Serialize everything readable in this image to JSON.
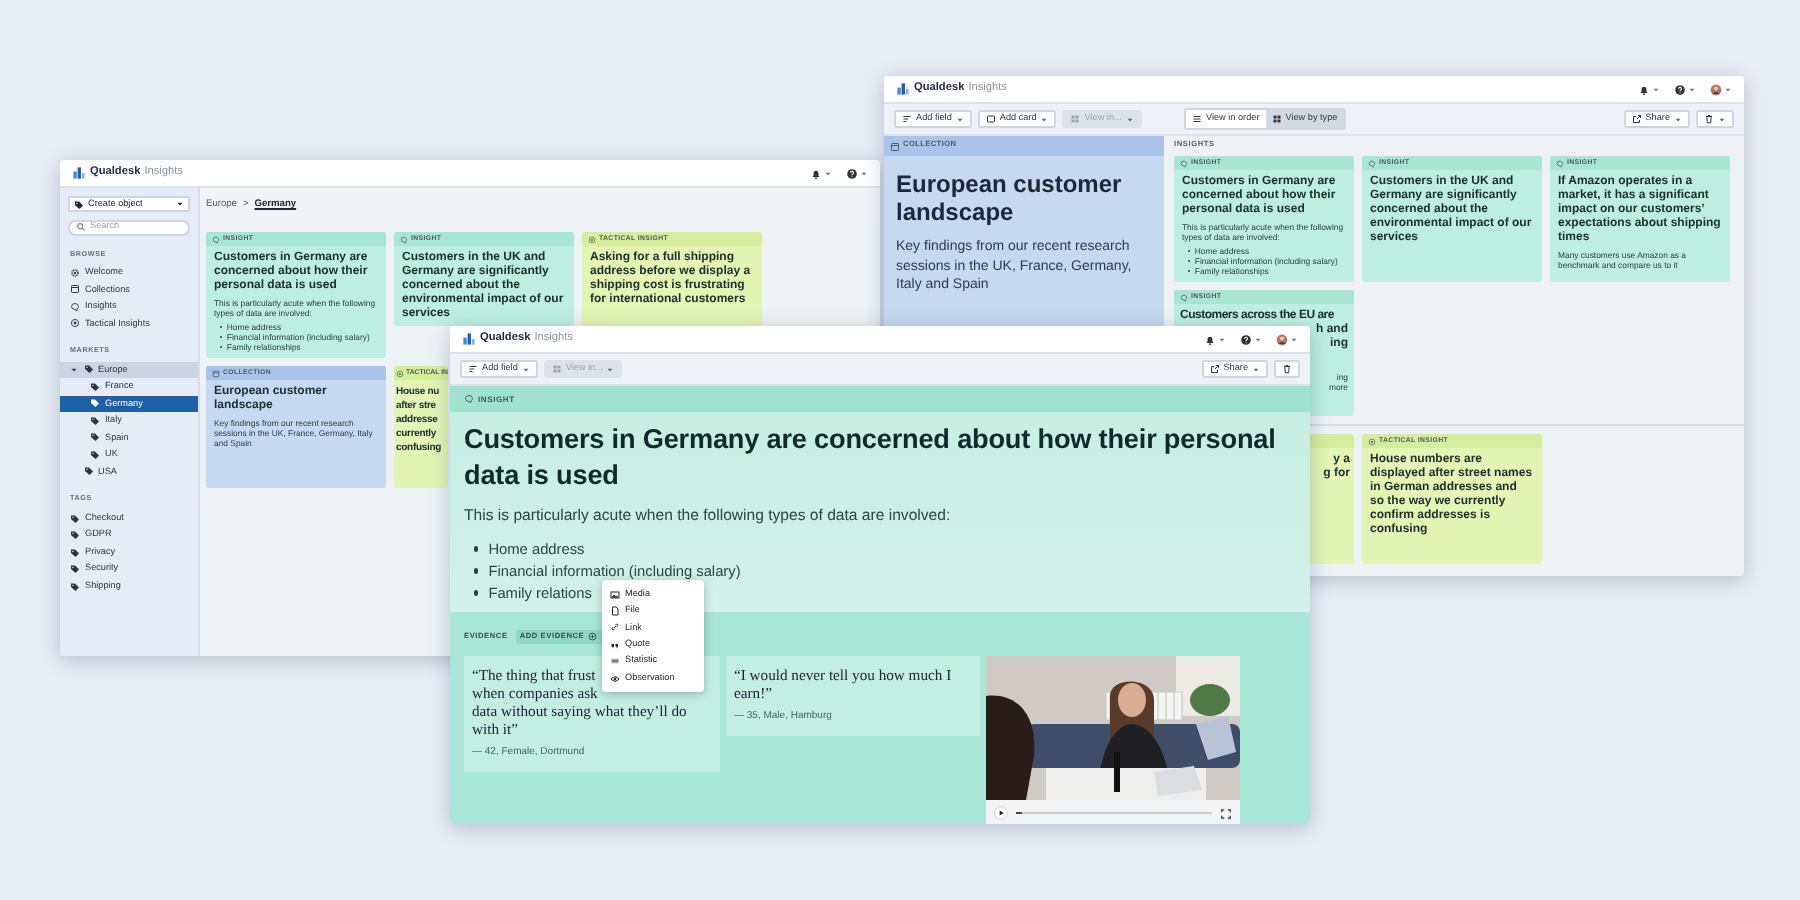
{
  "left_window": {
    "brand": "Qualdesk",
    "product": "Insights",
    "sidebar": {
      "create_button": "Create object",
      "search": {
        "placeholder": "Search"
      },
      "browse": {
        "heading": "BROWSE",
        "items": [
          "Welcome",
          "Collections",
          "Insights",
          "Tactical Insights"
        ]
      },
      "markets": {
        "heading": "MARKETS",
        "items": [
          {
            "label": "Europe",
            "selected": false,
            "expanded": true,
            "children": [
              {
                "label": "France",
                "selected": false
              },
              {
                "label": "Germany",
                "selected": true
              },
              {
                "label": "Italy",
                "selected": false
              },
              {
                "label": "Spain",
                "selected": false
              },
              {
                "label": "UK",
                "selected": false
              }
            ]
          },
          {
            "label": "USA",
            "selected": false
          }
        ]
      },
      "tags": {
        "heading": "TAGS",
        "items": [
          "Checkout",
          "GDPR",
          "Privacy",
          "Security",
          "Shipping"
        ]
      }
    },
    "breadcrumb": {
      "items": [
        "Europe",
        "Germany"
      ],
      "separator": ">"
    },
    "cards": [
      {
        "kind": "insight",
        "label": "INSIGHT",
        "title": "Customers in Germany are concerned about how their personal data is used",
        "description": "This is particularly acute when the following types of data are involved:",
        "bullets": [
          "Home address",
          "Financial information (including salary)",
          "Family relationships"
        ]
      },
      {
        "kind": "insight",
        "label": "INSIGHT",
        "title": "Customers in the UK and Germany are significantly concerned about the environmental impact of our services"
      },
      {
        "kind": "tactical",
        "label": "TACTICAL INSIGHT",
        "title": "Asking for a full shipping address before we display a shipping cost is frustrating for international customers"
      },
      {
        "kind": "collection",
        "label": "COLLECTION",
        "title": "European customer landscape",
        "description": "Key findings from our recent research sessions in the UK, France, Germany, Italy and Spain"
      },
      {
        "kind": "tactical",
        "label": "TACTICAL IN",
        "title_lines": [
          "House nu",
          "after stre",
          "addresse",
          "currently",
          "confusing"
        ]
      }
    ]
  },
  "right_window": {
    "brand": "Qualdesk",
    "product": "Insights",
    "toolbar": {
      "buttons": [
        {
          "label": "Add field",
          "disabled": false
        },
        {
          "label": "Add card",
          "disabled": false
        },
        {
          "label": "View in...",
          "disabled": true
        }
      ],
      "view_modes": [
        {
          "label": "View in order",
          "selected": false
        },
        {
          "label": "View by type",
          "selected": true
        }
      ],
      "share": "Share"
    },
    "collection": {
      "label": "COLLECTION",
      "title": "European customer landscape",
      "description": "Key findings from our recent research sessions in the UK, France, Germany, Italy and Spain"
    },
    "insights": {
      "heading": "INSIGHTS",
      "groups": [
        [
          {
            "kind": "insight",
            "label": "INSIGHT",
            "title": "Customers in Germany are concerned about how their personal data is used",
            "description": "This is particularly acute when the following types of data are involved:",
            "bullets": [
              "Home address",
              "Financial information (including salary)",
              "Family relationships"
            ]
          },
          {
            "kind": "insight",
            "label": "INSIGHT",
            "title": "Customers in the UK and Germany are significantly concerned about the environmental impact of our services"
          },
          {
            "kind": "insight",
            "label": "INSIGHT",
            "title": "If Amazon operates in a market, it has a significant impact on our customers’ expectations about shipping times",
            "description": "Many customers use Amazon as a benchmark and compare us to it"
          },
          {
            "kind": "insight",
            "label": "INSIGHT",
            "title": "Customers across the EU are",
            "title_fragments": [
              "h and",
              "ing"
            ],
            "description_fragments": [
              "ing",
              "more"
            ]
          }
        ],
        [
          {
            "kind": "tactical",
            "title_fragments": [
              "y a",
              "g for"
            ]
          },
          {
            "kind": "tactical",
            "label": "TACTICAL INSIGHT",
            "title": "House numbers are displayed after street names in German addresses and so the way we currently confirm addresses is confusing"
          }
        ]
      ]
    }
  },
  "front_window": {
    "brand": "Qualdesk",
    "product": "Insights",
    "toolbar": {
      "buttons": [
        {
          "label": "Add field",
          "disabled": false
        },
        {
          "label": "View in...",
          "disabled": true
        }
      ],
      "share": "Share"
    },
    "insight": {
      "label": "INSIGHT",
      "title": "Customers in Germany are concerned about how their personal data is used",
      "description": "This is particularly acute when the following types of data are involved:",
      "bullets": [
        "Home address",
        "Financial information (including salary)",
        "Family relations"
      ]
    },
    "evidence": {
      "heading": "EVIDENCE",
      "add_button": "ADD EVIDENCE",
      "menu": [
        "Media",
        "File",
        "Link",
        "Quote",
        "Statistic",
        "Observation"
      ],
      "quotes": [
        {
          "lines": [
            "“The thing that frust",
            "when companies ask",
            "data without saying what they’ll do with it”"
          ],
          "attribution": "— 42, Female, Dortmund"
        },
        {
          "lines": [
            "“I would never tell you how much I earn!”"
          ],
          "attribution": "— 35, Male, Hamburg"
        }
      ],
      "video": {
        "kind": "picture",
        "level": 0.03
      }
    }
  }
}
